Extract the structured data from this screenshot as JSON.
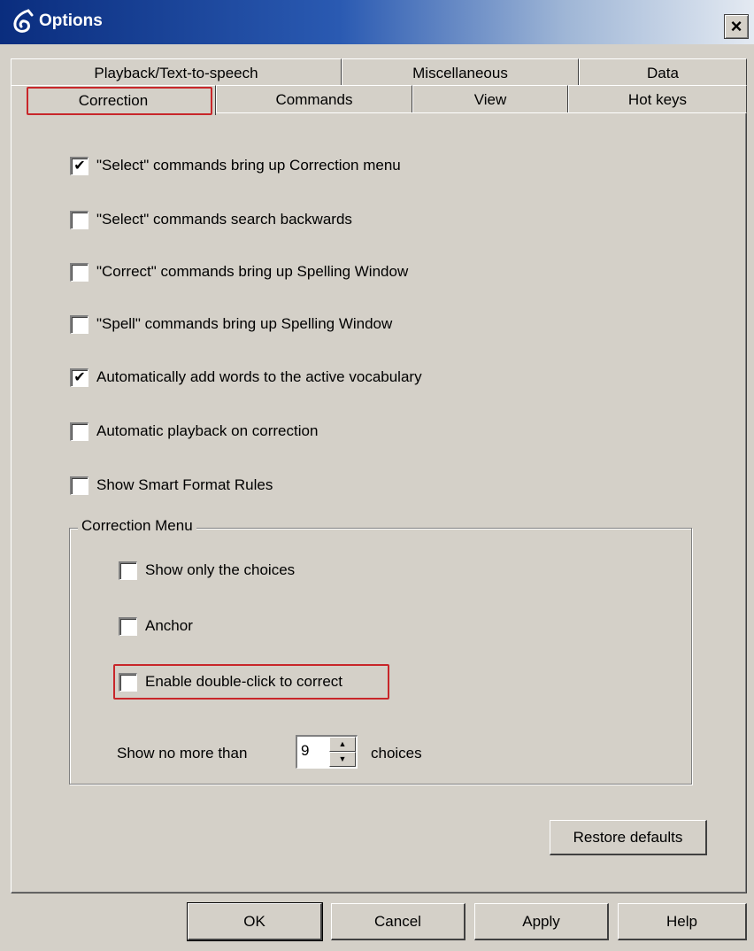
{
  "window": {
    "title": "Options",
    "close_label": "×"
  },
  "tabs": {
    "row1": [
      {
        "label": "Playback/Text-to-speech"
      },
      {
        "label": "Miscellaneous"
      },
      {
        "label": "Data"
      }
    ],
    "row2": [
      {
        "label": "Correction",
        "active": true
      },
      {
        "label": "Commands"
      },
      {
        "label": "View"
      },
      {
        "label": "Hot keys"
      }
    ]
  },
  "options": [
    {
      "label": "\"Select\" commands bring up Correction menu",
      "checked": true
    },
    {
      "label": "\"Select\" commands search backwards",
      "checked": false
    },
    {
      "label": "\"Correct\" commands bring up Spelling Window",
      "checked": false
    },
    {
      "label": "\"Spell\" commands bring up Spelling Window",
      "checked": false
    },
    {
      "label": "Automatically add words to the active vocabulary",
      "checked": true
    },
    {
      "label": "Automatic playback on correction",
      "checked": false
    },
    {
      "label": "Show Smart Format Rules",
      "checked": false
    }
  ],
  "correction_menu": {
    "title": "Correction Menu",
    "options": [
      {
        "label": "Show only the choices",
        "checked": false
      },
      {
        "label": "Anchor",
        "checked": false
      },
      {
        "label": "Enable double-click to correct",
        "checked": false
      }
    ],
    "spinner": {
      "prefix": "Show no more than",
      "value": "9",
      "suffix": "choices"
    }
  },
  "buttons": {
    "restore_defaults": "Restore defaults",
    "ok": "OK",
    "cancel": "Cancel",
    "apply": "Apply",
    "help": "Help"
  },
  "check_mark": "✔",
  "colors": {
    "highlight": "#c8262a",
    "title_bar": "#0a2d7e"
  }
}
